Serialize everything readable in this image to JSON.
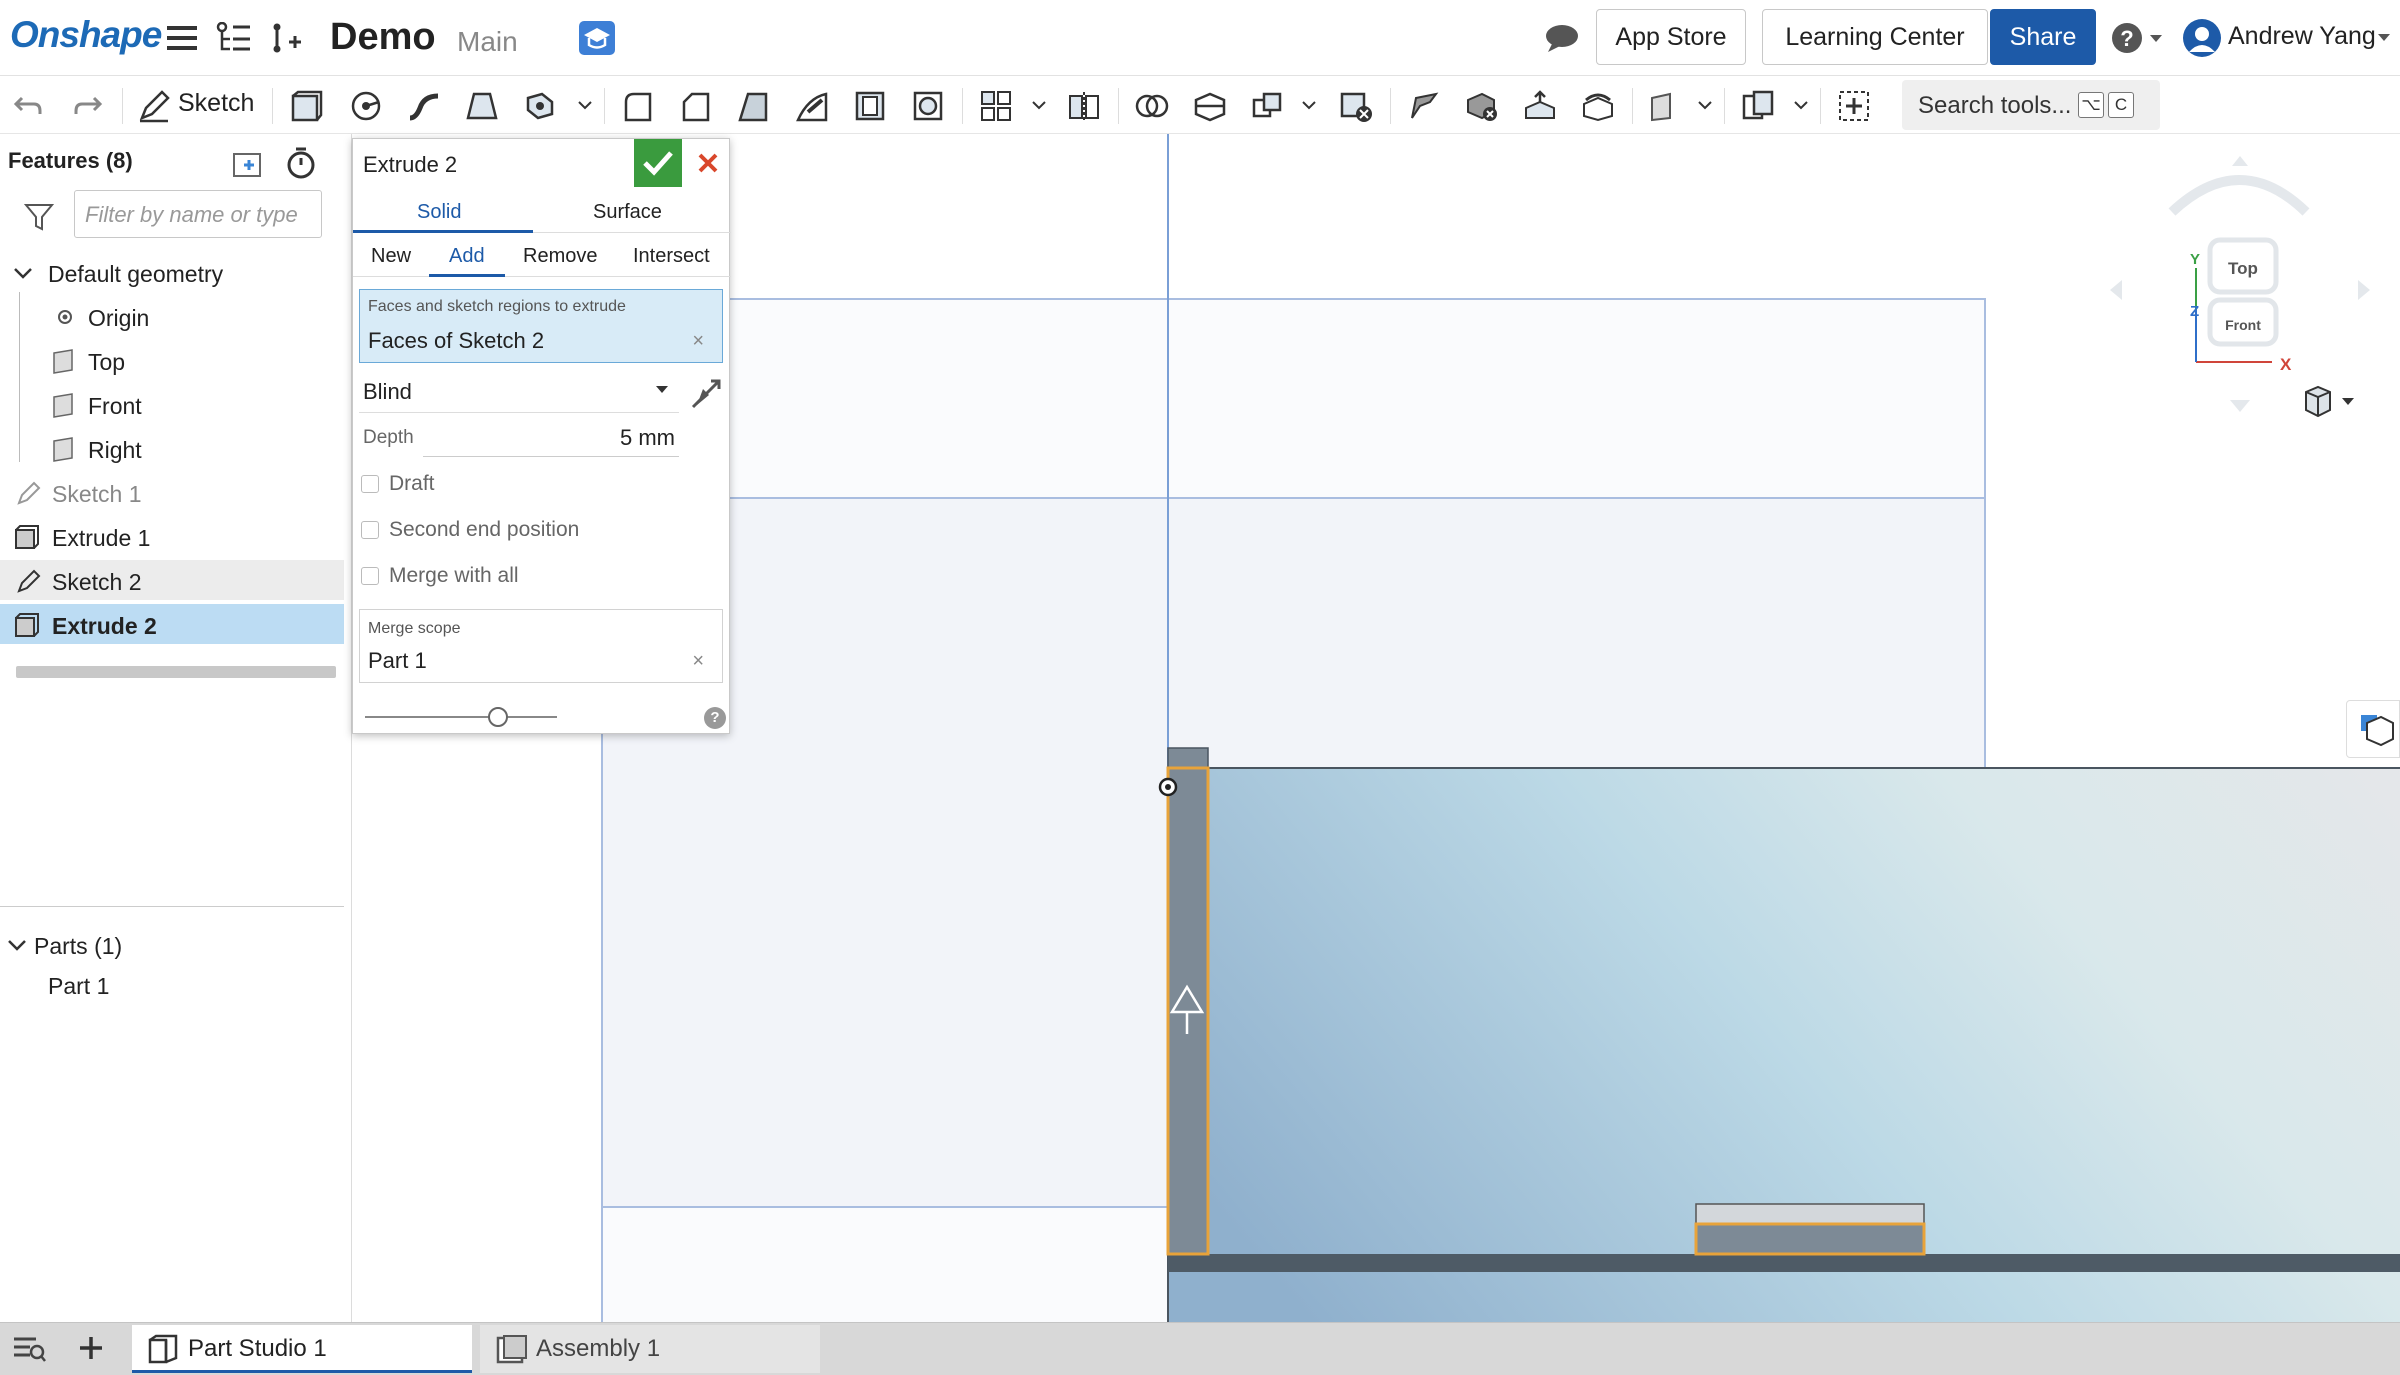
{
  "header": {
    "logo": "Onshape",
    "document_title": "Demo",
    "branch": "Main",
    "app_store": "App Store",
    "learning_center": "Learning Center",
    "share": "Share",
    "user_name": "Andrew Yang",
    "icons": [
      "menu-icon",
      "versions-icon",
      "branch-icon",
      "learning-cap-icon",
      "comments-icon",
      "help-icon",
      "user-avatar-icon"
    ]
  },
  "toolbar": {
    "sketch_label": "Sketch",
    "search_placeholder": "Search tools...",
    "search_shortcut_1": "⌥",
    "search_shortcut_2": "C",
    "tools": [
      "undo-icon",
      "redo-icon",
      "sketch-icon",
      "extrude-icon",
      "revolve-icon",
      "sweep-icon",
      "loft-icon",
      "thicken-icon",
      "fillet-icon",
      "chamfer-icon",
      "draft-icon",
      "rib-icon",
      "shell-icon",
      "hole-icon",
      "pattern-icon",
      "mirror-icon",
      "boolean-icon",
      "split-icon",
      "transform-icon",
      "delete-part-icon",
      "modify-fillet-icon",
      "delete-face-icon",
      "move-face-icon",
      "replace-face-icon",
      "plane-icon",
      "mate-connector-icon",
      "add-custom-feature-icon"
    ]
  },
  "feature_tree": {
    "title": "Features (8)",
    "filter_placeholder": "Filter by name or type",
    "default_geometry": "Default geometry",
    "items": [
      {
        "label": "Origin",
        "icon": "origin-icon"
      },
      {
        "label": "Top",
        "icon": "plane-icon"
      },
      {
        "label": "Front",
        "icon": "plane-icon"
      },
      {
        "label": "Right",
        "icon": "plane-icon"
      },
      {
        "label": "Sketch 1",
        "icon": "sketch-icon"
      },
      {
        "label": "Extrude 1",
        "icon": "extrude-icon"
      },
      {
        "label": "Sketch 2",
        "icon": "sketch-icon"
      },
      {
        "label": "Extrude 2",
        "icon": "extrude-icon"
      }
    ],
    "parts_header": "Parts (1)",
    "parts": [
      "Part 1"
    ]
  },
  "dialog": {
    "title": "Extrude 2",
    "tabs": [
      "Solid",
      "Surface"
    ],
    "active_tab": "Solid",
    "operations": [
      "New",
      "Add",
      "Remove",
      "Intersect"
    ],
    "active_operation": "Add",
    "faces_caption": "Faces and sketch regions to extrude",
    "faces_value": "Faces of Sketch 2",
    "end_type": "Blind",
    "depth_label": "Depth",
    "depth_value": "5 mm",
    "checkboxes": {
      "draft": "Draft",
      "second_end": "Second end position",
      "merge_all": "Merge with all"
    },
    "merge_scope_caption": "Merge scope",
    "merge_scope_value": "Part 1",
    "clear_symbol": "×",
    "help_symbol": "?"
  },
  "viewcube": {
    "top": "Top",
    "front": "Front",
    "axis_x": "X",
    "axis_y": "Y",
    "axis_z": "Z"
  },
  "bottom_tabs": {
    "tabs": [
      {
        "label": "Part Studio 1",
        "active": true
      },
      {
        "label": "Assembly 1",
        "active": false
      }
    ]
  },
  "colors": {
    "brand": "#1d6ab6",
    "share": "#1d5aa8",
    "confirm": "#3a9b3e",
    "cancel": "#d9472b",
    "selection": "#bcdcf3",
    "highlight_edge": "#e8a33a"
  }
}
